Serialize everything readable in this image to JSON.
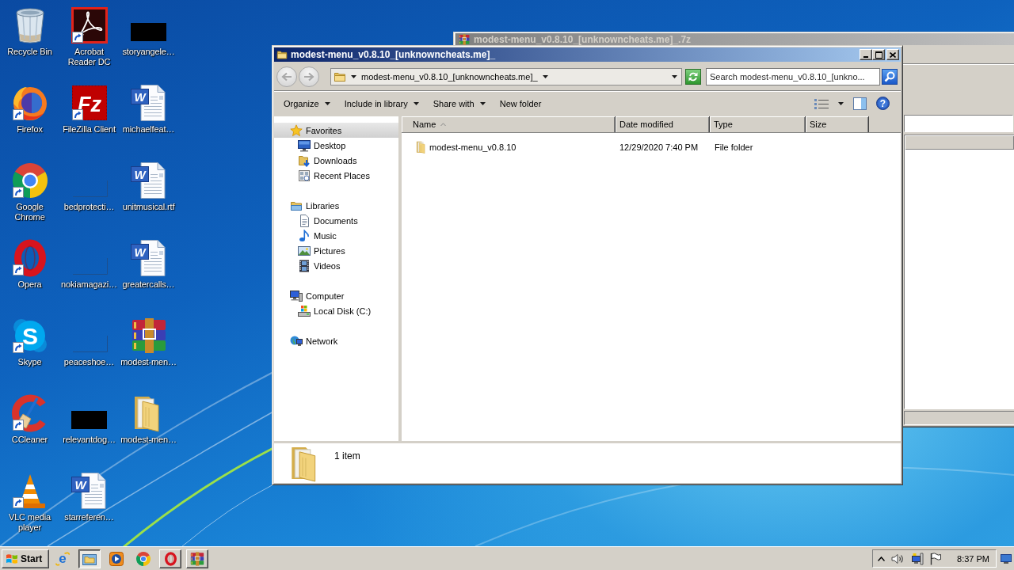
{
  "desktop": {
    "icons": [
      {
        "label": "Recycle Bin",
        "kind": "recycle-bin",
        "shortcut": false
      },
      {
        "label": "Firefox",
        "kind": "firefox",
        "shortcut": true
      },
      {
        "label": "Google Chrome",
        "kind": "chrome",
        "shortcut": true
      },
      {
        "label": "Opera",
        "kind": "opera",
        "shortcut": true
      },
      {
        "label": "Skype",
        "kind": "skype",
        "glyph": "S",
        "shortcut": true
      },
      {
        "label": "CCleaner",
        "kind": "ccleaner",
        "shortcut": true
      },
      {
        "label": "VLC media player",
        "kind": "traffic-cone",
        "shortcut": true
      },
      {
        "label": "Acrobat Reader DC",
        "kind": "pdf-reader",
        "shortcut": true
      },
      {
        "label": "FileZilla Client",
        "kind": "filezilla",
        "glyph": "Fz",
        "shortcut": true
      },
      {
        "label": "bedprotecti…",
        "kind": "file",
        "shortcut": false
      },
      {
        "label": "nokiamagazi…",
        "kind": "file",
        "shortcut": false
      },
      {
        "label": "peaceshoe…",
        "kind": "file",
        "shortcut": false
      },
      {
        "label": "relevantdog…",
        "kind": "thumbnail",
        "shortcut": false
      },
      {
        "label": "starreferen…",
        "kind": "word-document",
        "glyph": "W",
        "shortcut": false
      },
      {
        "label": "storyangele…",
        "kind": "thumbnail",
        "shortcut": false
      },
      {
        "label": "michaelfeat…",
        "kind": "word-document",
        "glyph": "W",
        "shortcut": false
      },
      {
        "label": "unitmusical.rtf",
        "kind": "word-document",
        "glyph": "W",
        "shortcut": false
      },
      {
        "label": "greatercalls…",
        "kind": "word-document",
        "glyph": "W",
        "shortcut": false
      },
      {
        "label": "modest-men…",
        "kind": "archive",
        "shortcut": false
      },
      {
        "label": "modest-men…",
        "kind": "folder",
        "shortcut": false
      }
    ]
  },
  "background_window": {
    "title": "modest-menu_v0.8.10_[unknowncheats.me]_.7z"
  },
  "explorer": {
    "title": "modest-menu_v0.8.10_[unknowncheats.me]_",
    "nav_buttons": [
      {
        "kind": "back",
        "disabled": true
      },
      {
        "kind": "forward",
        "disabled": true
      }
    ],
    "address": "modest-menu_v0.8.10_[unknowncheats.me]_",
    "search": {
      "placeholder": "Search modest-menu_v0.8.10_[unkno..."
    },
    "toolbar": [
      {
        "label": "Organize",
        "dropdown": true
      },
      {
        "label": "Include in library",
        "dropdown": true
      },
      {
        "label": "Share with",
        "dropdown": true
      },
      {
        "label": "New folder",
        "dropdown": false
      }
    ],
    "help": "?",
    "nav_pane": [
      {
        "label": "Favorites",
        "kind": "star",
        "selected": true,
        "children": [
          {
            "label": "Desktop",
            "kind": "desktop",
            "selected": false
          },
          {
            "label": "Downloads",
            "kind": "downloads",
            "selected": false
          },
          {
            "label": "Recent Places",
            "kind": "recent",
            "selected": false
          }
        ]
      },
      {
        "label": "Libraries",
        "kind": "libraries",
        "selected": false,
        "children": [
          {
            "label": "Documents",
            "kind": "documents",
            "selected": false
          },
          {
            "label": "Music",
            "kind": "music",
            "selected": false
          },
          {
            "label": "Pictures",
            "kind": "pictures",
            "selected": false
          },
          {
            "label": "Videos",
            "kind": "videos",
            "selected": false
          }
        ]
      },
      {
        "label": "Computer",
        "kind": "computer",
        "selected": false,
        "children": [
          {
            "label": "Local Disk (C:)",
            "kind": "disk",
            "selected": false
          }
        ]
      },
      {
        "label": "Network",
        "kind": "network",
        "selected": false
      }
    ],
    "columns": [
      {
        "label": "Name",
        "sorted": true
      },
      {
        "label": "Date modified",
        "sorted": false
      },
      {
        "label": "Type",
        "sorted": false
      },
      {
        "label": "Size",
        "sorted": false
      }
    ],
    "rows": [
      {
        "name": "modest-menu_v0.8.10",
        "date_modified": "12/29/2020 7:40 PM",
        "type": "File folder"
      }
    ],
    "details": {
      "count": "1 item"
    }
  },
  "taskbar": {
    "start": "Start",
    "items": [
      {
        "kind": "browser",
        "glyph": "e",
        "running": false,
        "selected": false
      },
      {
        "kind": "explorer",
        "running": true,
        "selected": true
      },
      {
        "kind": "media-player",
        "running": false,
        "selected": false
      },
      {
        "kind": "chrome",
        "running": false,
        "selected": false
      },
      {
        "kind": "opera",
        "running": true,
        "selected": false
      },
      {
        "kind": "archive",
        "running": true,
        "selected": false
      }
    ],
    "clock": "8:37 PM"
  }
}
